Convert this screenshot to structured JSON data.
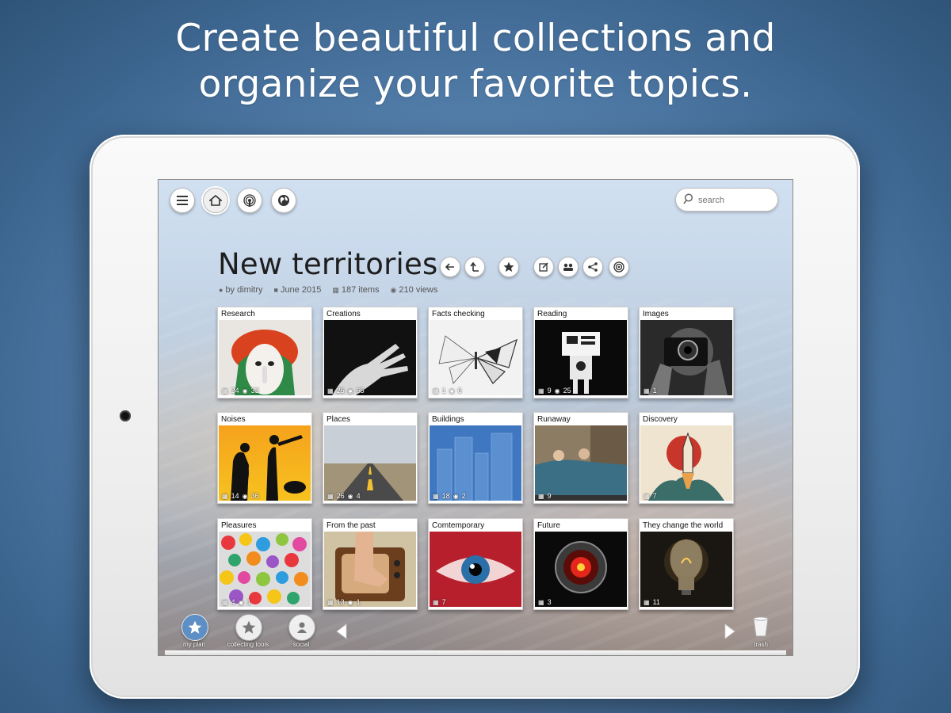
{
  "headline": {
    "line1": "Create beautiful collections and",
    "line2": "organize your favorite topics."
  },
  "toolbar": {
    "menu_icon": "hamburger-icon",
    "home_icon": "home-icon",
    "podcast_icon": "broadcast-icon",
    "globe_icon": "globe-icon"
  },
  "search": {
    "placeholder": "search"
  },
  "collection": {
    "title": "New territories",
    "author": "by dimitry",
    "date": "June 2015",
    "items": "187 items",
    "views": "210 views"
  },
  "cards": [
    {
      "label": "Research",
      "items": "24",
      "views": "33"
    },
    {
      "label": "Creations",
      "items": "25",
      "views": "65"
    },
    {
      "label": "Facts checking",
      "items": "1",
      "views": "6"
    },
    {
      "label": "Reading",
      "items": "9",
      "views": "25"
    },
    {
      "label": "Images",
      "items": "1",
      "views": ""
    },
    {
      "label": "Noises",
      "items": "14",
      "views": "36"
    },
    {
      "label": "Places",
      "items": "26",
      "views": "4"
    },
    {
      "label": "Buildings",
      "items": "18",
      "views": "2"
    },
    {
      "label": "Runaway",
      "items": "9",
      "views": ""
    },
    {
      "label": "Discovery",
      "items": "7",
      "views": ""
    },
    {
      "label": "Pleasures",
      "items": "4",
      "views": "1"
    },
    {
      "label": "From the past",
      "items": "13",
      "views": "1"
    },
    {
      "label": "Comtemporary",
      "items": "7",
      "views": ""
    },
    {
      "label": "Future",
      "items": "3",
      "views": ""
    },
    {
      "label": "They change the world",
      "items": "11",
      "views": ""
    }
  ],
  "dock": {
    "my_plan": "my plan",
    "collecting_tools": "collecting tools",
    "social": "social",
    "trash": "trash"
  },
  "colors": {
    "accent": "#5d8fc4",
    "background": "#4a78a6"
  }
}
